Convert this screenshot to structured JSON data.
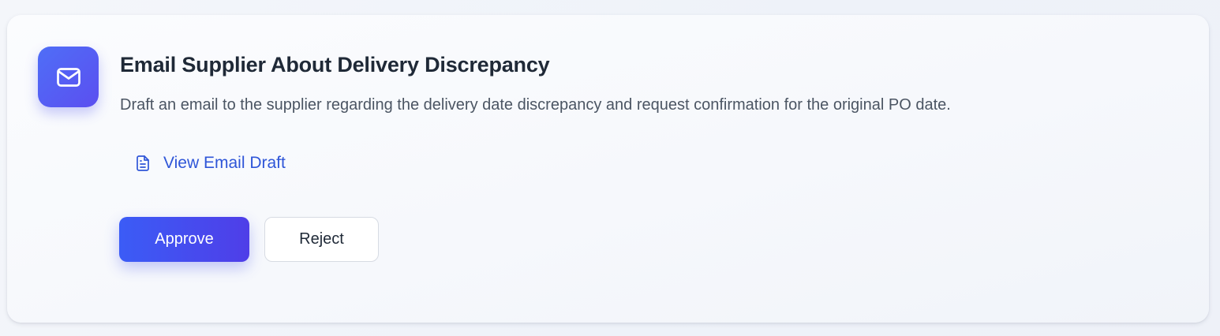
{
  "task": {
    "title": "Email Supplier About Delivery Discrepancy",
    "description": "Draft an email to the supplier regarding the delivery date discrepancy and request confirmation for the original PO date.",
    "icon": "mail-icon",
    "link": {
      "label": "View Email Draft",
      "icon": "document-icon"
    },
    "actions": {
      "approve_label": "Approve",
      "reject_label": "Reject"
    }
  },
  "colors": {
    "accent": "#3b5cf6",
    "accent_secondary": "#4f3ee8",
    "link": "#2f56d8",
    "title": "#1f2937",
    "body_text": "#4b5563"
  }
}
